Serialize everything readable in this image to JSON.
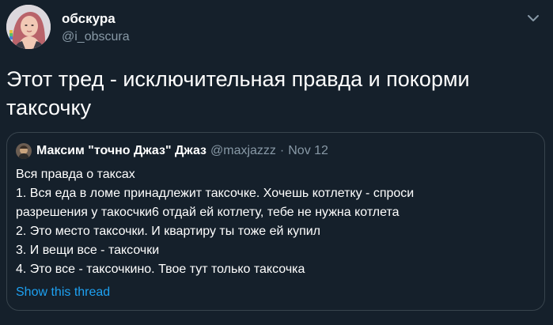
{
  "tweet": {
    "display_name": "обскура",
    "handle": "@i_obscura",
    "text": "Этот тред - исключительная правда и покорми таксочку",
    "more_icon": "chevron-down-icon"
  },
  "quote": {
    "display_name": "Максим \"точно Джаз\" Джаз",
    "handle": "@maxjazzz",
    "separator": "·",
    "date": "Nov 12",
    "lines": [
      "Вся правда о таксах",
      "1. Вся еда в ломе принадлежит таксочке. Хочешь котлетку - спроси",
      "разрешения у такосчки6 отдай ей котлету, тебе не нужна котлета",
      "2. Это место таксочки. И квартиру ты тоже ей купил",
      "3. И вещи все - таксочки",
      "4. Это все - таксочкино. Твое тут только таксочка"
    ],
    "show_thread_label": "Show this thread"
  },
  "colors": {
    "background": "#15202b",
    "border": "#38444d",
    "secondary_text": "#8899a6",
    "link": "#1da1f2"
  }
}
